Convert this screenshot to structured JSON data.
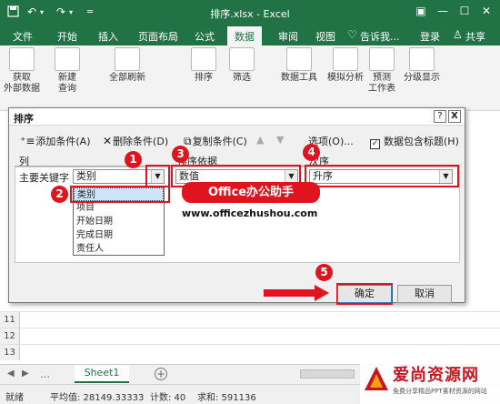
{
  "titlebar": {
    "title": "排序.xlsx - Excel",
    "save_icon": "save-icon",
    "undo_icon": "undo-icon",
    "redo_icon": "redo-icon",
    "colors": {
      "bg": "#217346",
      "fg": "#ffffff"
    }
  },
  "tabs": {
    "items": [
      "文件",
      "开始",
      "插入",
      "页面布局",
      "公式",
      "数据",
      "审阅",
      "视图"
    ],
    "active": "数据",
    "tell_me": "告诉我...",
    "login": "登录",
    "share": "共享"
  },
  "ribbon": {
    "groups": [
      {
        "label1": "获取",
        "label2": "外部数据",
        "icon": "database-icon"
      },
      {
        "label1": "新建",
        "label2": "查询",
        "icon": "table-query-icon"
      },
      {
        "label1": "全部刷新",
        "label2": "",
        "icon": "refresh-icon"
      },
      {
        "label1": "排序",
        "label2": "",
        "icon": "sort-az-icon"
      },
      {
        "label1": "筛选",
        "label2": "",
        "icon": "filter-icon"
      },
      {
        "label1": "数据工具",
        "label2": "",
        "icon": "data-tools-icon"
      },
      {
        "label1": "模拟分析",
        "label2": "",
        "icon": "what-if-icon"
      },
      {
        "label1": "预测",
        "label2": "工作表",
        "icon": "forecast-icon"
      },
      {
        "label1": "分级显示",
        "label2": "",
        "icon": "outline-icon"
      }
    ]
  },
  "dialog": {
    "title": "排序",
    "help_label": "?",
    "close_label": "X",
    "add_condition": "添加条件(A)",
    "delete_condition": "删除条件(D)",
    "copy_condition": "复制条件(C)",
    "options": "选项(O)...",
    "has_headers": "数据包含标题(H)",
    "has_headers_checked": true,
    "col_header": "列",
    "sort_on_header": "排序依据",
    "order_header": "次序",
    "main_key_label": "主要关键字",
    "main_key_value": "类别",
    "sort_on_value": "数值",
    "order_value": "升序",
    "dropdown_items": [
      "类别",
      "项目",
      "开始日期",
      "完成日期",
      "责任人"
    ],
    "dropdown_selected": "类别",
    "ok": "确定",
    "cancel": "取消"
  },
  "annotations": {
    "badges": [
      "1",
      "2",
      "3",
      "4",
      "5"
    ],
    "callout": "Office办公助手",
    "website": "www.officezhushou.com",
    "color": "#e0141e"
  },
  "sheet": {
    "row_numbers": [
      "11",
      "12",
      "13",
      "14",
      "15",
      "16",
      "17"
    ],
    "tab_name": "Sheet1",
    "add_sheet": "+"
  },
  "statusbar": {
    "ready": "就绪",
    "average": "平均值: 28149.33333",
    "count": "计数: 40",
    "sum": "求和: 591136"
  },
  "watermark": {
    "name": "爱尚资源网",
    "tagline": "免费分享精品PPT素材资源的网站"
  }
}
